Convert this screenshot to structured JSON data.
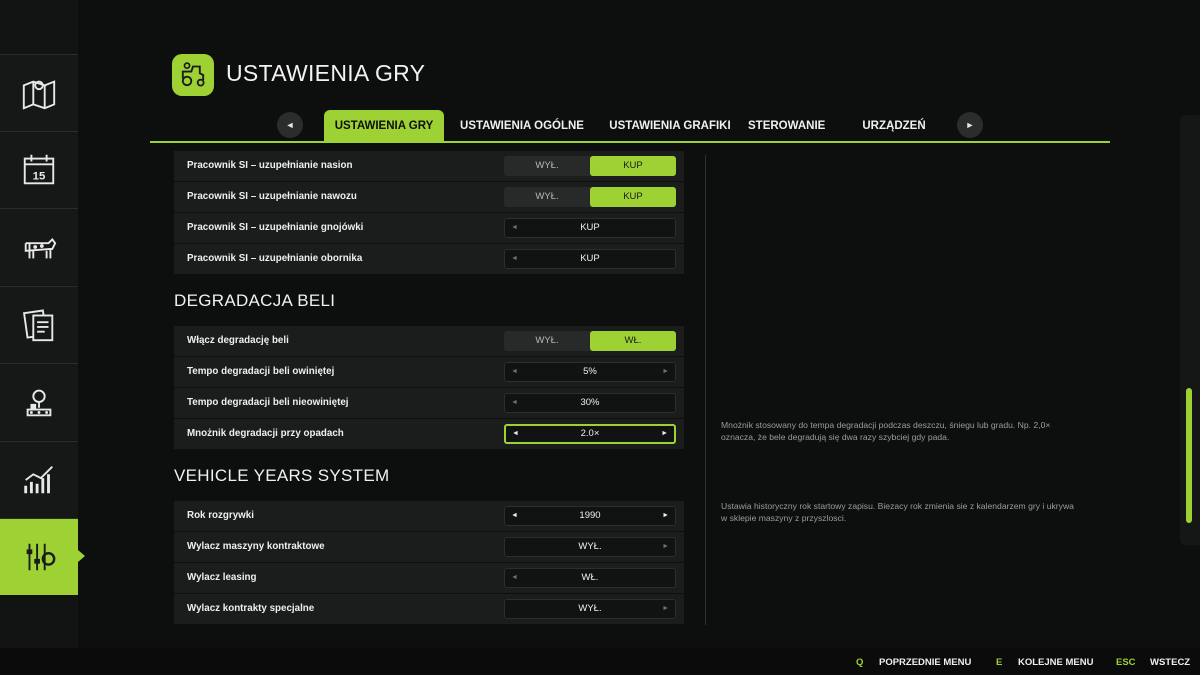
{
  "header": {
    "title": "USTAWIENIA GRY"
  },
  "tabs": [
    {
      "label": "USTAWIENIA GRY",
      "active": true
    },
    {
      "label": "USTAWIENIA OGÓLNE",
      "active": false
    },
    {
      "label": "USTAWIENIA GRAFIKI",
      "active": false
    },
    {
      "label": "STEROWANIE",
      "active": false
    },
    {
      "label": "URZĄDZEŃ",
      "active": false
    }
  ],
  "tab_nav": {
    "prev": "◄",
    "next": "►"
  },
  "sidebar": {
    "items": [
      {
        "icon": "map-icon"
      },
      {
        "icon": "calendar-icon",
        "label": "15"
      },
      {
        "icon": "cow-icon"
      },
      {
        "icon": "contracts-icon"
      },
      {
        "icon": "production-icon"
      },
      {
        "icon": "statistics-icon"
      },
      {
        "icon": "settings-sliders-icon",
        "active": true
      }
    ]
  },
  "rows_top": [
    {
      "label": "Pracownik SI – uzupełnianie nasion",
      "type": "toggle",
      "options": [
        "WYŁ.",
        "KUP"
      ],
      "selected": 1
    },
    {
      "label": "Pracownik SI – uzupełnianie nawozu",
      "type": "toggle",
      "options": [
        "WYŁ.",
        "KUP"
      ],
      "selected": 1
    },
    {
      "label": "Pracownik SI – uzupełnianie gnojówki",
      "type": "select",
      "value": "KUP"
    },
    {
      "label": "Pracownik SI – uzupełnianie obornika",
      "type": "select",
      "value": "KUP"
    }
  ],
  "section_bale": {
    "title": "DEGRADACJA BELI",
    "rows": [
      {
        "label": "Włącz degradację beli",
        "type": "toggle",
        "options": [
          "WYŁ.",
          "WŁ."
        ],
        "selected": 1
      },
      {
        "label": "Tempo degradacji beli owiniętej",
        "type": "select",
        "value": "5%"
      },
      {
        "label": "Tempo degradacji beli nieowiniętej",
        "type": "select",
        "value": "30%"
      },
      {
        "label": "Mnożnik degradacji przy opadach",
        "type": "select",
        "value": "2.0×",
        "focused": true
      }
    ],
    "description": "Mnożnik stosowany do tempa degradacji podczas deszczu, śniegu lub gradu. Np. 2,0× oznacza, że bele degradują się dwa razy szybciej gdy pada."
  },
  "section_vehicle": {
    "title": "VEHICLE YEARS SYSTEM",
    "rows": [
      {
        "label": "Rok rozgrywki",
        "type": "select",
        "value": "1990"
      },
      {
        "label": "Wylacz maszyny kontraktowe",
        "type": "select",
        "value": "WYŁ."
      },
      {
        "label": "Wylacz leasing",
        "type": "select",
        "value": "WŁ."
      },
      {
        "label": "Wylacz kontrakty specjalne",
        "type": "select",
        "value": "WYŁ."
      }
    ],
    "description": "Ustawia historyczny rok startowy zapisu. Biezacy rok zmienia sie z kalendarzem gry i ukrywa w sklepie maszyny z przyszlosci."
  },
  "footer": {
    "prev_key": "Q",
    "prev_label": "POPRZEDNIE MENU",
    "next_key": "E",
    "next_label": "KOLEJNE MENU",
    "back_key": "ESC",
    "back_label": "WSTECZ"
  },
  "colors": {
    "accent": "#9ed234",
    "background": "#0d0f0e",
    "row": "#1b1d1c"
  }
}
